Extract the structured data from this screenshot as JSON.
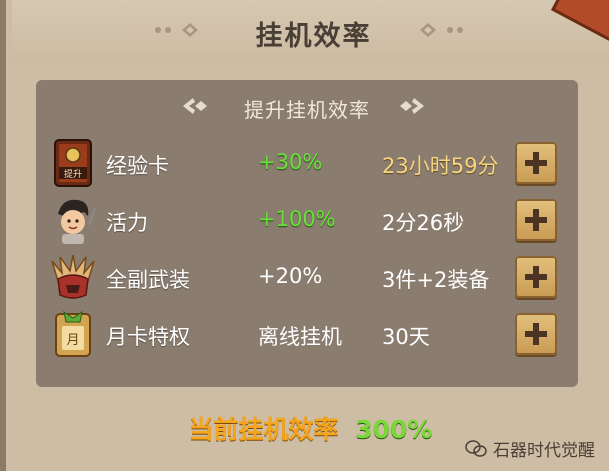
{
  "window": {
    "title": "挂机效率"
  },
  "section": {
    "subtitle": "提升挂机效率"
  },
  "rows": [
    {
      "icon": "experience-card-icon",
      "name": "经验卡",
      "value": "+30%",
      "value_style": "green",
      "detail": "23小时59分",
      "detail_style": "gold"
    },
    {
      "icon": "character-vitality-icon",
      "name": "活力",
      "value": "+100%",
      "value_style": "green",
      "detail": "2分26秒",
      "detail_style": "white"
    },
    {
      "icon": "armor-helmet-icon",
      "name": "全副武装",
      "value": "+20%",
      "value_style": "white",
      "detail": "3件+2装备",
      "detail_style": "white"
    },
    {
      "icon": "monthly-card-icon",
      "name": "月卡特权",
      "value": "离线挂机",
      "value_style": "white",
      "detail": "30天",
      "detail_style": "white"
    }
  ],
  "footer": {
    "label": "当前挂机效率",
    "value": "300%"
  },
  "watermark": {
    "text": "石器时代觉醒"
  },
  "icon_labels": {
    "experience_card": "提升",
    "monthly_card": "月"
  },
  "colors": {
    "green": "#6ae13a",
    "gold": "#f6d682",
    "orange": "#f5a51d",
    "button": "#d4aa62"
  }
}
